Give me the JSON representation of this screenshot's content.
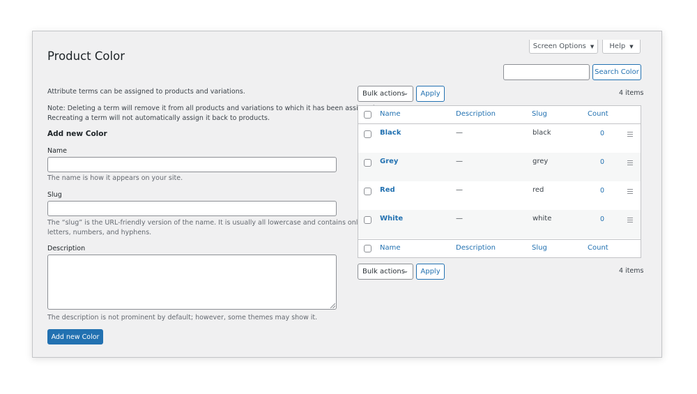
{
  "header": {
    "title": "Product Color",
    "screen_options_label": "Screen Options",
    "help_label": "Help",
    "search_button_label": "Search Color",
    "search_value": ""
  },
  "form": {
    "intro": "Attribute terms can be assigned to products and variations.",
    "note_line1": "Note: Deleting a term will remove it from all products and variations to which it has been assigned.",
    "note_line2": "Recreating a term will not automatically assign it back to products.",
    "heading": "Add new Color",
    "name_label": "Name",
    "name_value": "",
    "name_help": "The name is how it appears on your site.",
    "slug_label": "Slug",
    "slug_value": "",
    "slug_help_line1": "The “slug” is the URL-friendly version of the name. It is usually all lowercase and contains only",
    "slug_help_line2": "letters, numbers, and hyphens.",
    "description_label": "Description",
    "description_value": "",
    "description_help": "The description is not prominent by default; however, some themes may show it.",
    "submit_label": "Add new Color"
  },
  "table_nav": {
    "bulk_actions_label": "Bulk actions",
    "apply_label": "Apply",
    "items_count": "4 items"
  },
  "table": {
    "columns": {
      "name": "Name",
      "description": "Description",
      "slug": "Slug",
      "count": "Count"
    },
    "rows": [
      {
        "name": "Black",
        "description": "—",
        "slug": "black",
        "count": "0"
      },
      {
        "name": "Grey",
        "description": "—",
        "slug": "grey",
        "count": "0"
      },
      {
        "name": "Red",
        "description": "—",
        "slug": "red",
        "count": "0"
      },
      {
        "name": "White",
        "description": "—",
        "slug": "white",
        "count": "0"
      }
    ]
  },
  "icons": {
    "caret": "caret-down-icon",
    "chevron": "chevron-down-icon",
    "drag": "drag-handle-icon"
  },
  "colors": {
    "accent": "#2271b1",
    "background": "#f0f0f1",
    "text": "#1d2327"
  }
}
